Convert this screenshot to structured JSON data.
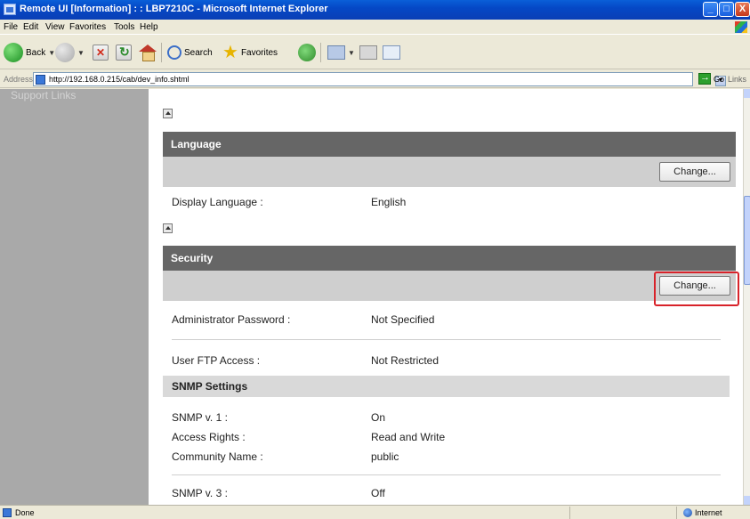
{
  "window": {
    "title": "Remote UI [Information] : : LBP7210C - Microsoft Internet Explorer",
    "controls": {
      "minimize": "_",
      "maximize": "□",
      "close": "X"
    }
  },
  "menubar": [
    "File",
    "Edit",
    "View",
    "Favorites",
    "Tools",
    "Help"
  ],
  "toolbar": {
    "back_label": "Back",
    "search_label": "Search",
    "favorites_label": "Favorites"
  },
  "address": {
    "label": "Address",
    "url": "http://192.168.0.215/cab/dev_info.shtml",
    "go_label": "Go",
    "links_label": "Links"
  },
  "sidebar": {
    "support_links": "Support Links"
  },
  "language": {
    "header": "Language",
    "change_button": "Change...",
    "display_language_label": "Display Language :",
    "display_language_value": "English"
  },
  "security": {
    "header": "Security",
    "change_button": "Change...",
    "admin_password_label": "Administrator Password :",
    "admin_password_value": "Not Specified",
    "ftp_access_label": "User FTP Access :",
    "ftp_access_value": "Not Restricted",
    "snmp_header": "SNMP Settings",
    "snmp_v1_label": "SNMP v. 1 :",
    "snmp_v1_value": "On",
    "access_rights_label": "Access Rights :",
    "access_rights_value": "Read and Write",
    "community_label": "Community Name :",
    "community_value": "public",
    "snmp_v3_label": "SNMP v. 3 :",
    "snmp_v3_value": "Off"
  },
  "statusbar": {
    "done": "Done",
    "zone": "Internet"
  },
  "colors": {
    "section_header": "#666666",
    "section_bar": "#cfcfcf",
    "sidebar": "#a9a9a9",
    "highlight": "#d8232a"
  }
}
